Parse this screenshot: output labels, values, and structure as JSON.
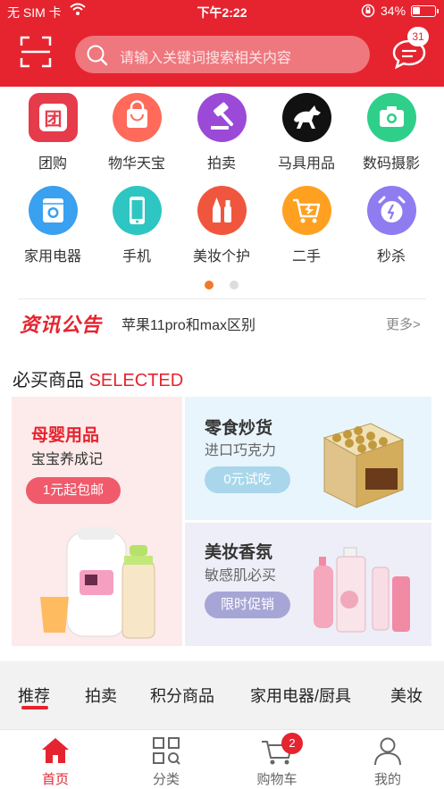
{
  "status_bar": {
    "carrier": "无 SIM 卡",
    "time": "下午2:22",
    "battery": "34%"
  },
  "header": {
    "search_placeholder": "请输入关键词搜索相关内容",
    "message_count": "31"
  },
  "categories": [
    {
      "label": "团购",
      "icon": "group-buy-icon",
      "color": "#e63b4b"
    },
    {
      "label": "物华天宝",
      "icon": "shopping-bag-icon",
      "color": "#ff6a5a"
    },
    {
      "label": "拍卖",
      "icon": "gavel-icon",
      "color": "#9b4ad8"
    },
    {
      "label": "马具用品",
      "icon": "horse-icon",
      "color": "#111111"
    },
    {
      "label": "数码摄影",
      "icon": "camera-icon",
      "color": "#2fcf8a"
    },
    {
      "label": "家用电器",
      "icon": "washing-machine-icon",
      "color": "#3aa0f0"
    },
    {
      "label": "手机",
      "icon": "phone-icon",
      "color": "#2ec6c2"
    },
    {
      "label": "美妆个护",
      "icon": "cosmetics-icon",
      "color": "#f0563e"
    },
    {
      "label": "二手",
      "icon": "cart-icon",
      "color": "#ffa020"
    },
    {
      "label": "秒杀",
      "icon": "alarm-clock-icon",
      "color": "#8e7cf0"
    }
  ],
  "pager": {
    "active_color": "#f07a2a",
    "inactive_color": "#dddddd"
  },
  "news": {
    "logo": "资讯公告",
    "headline": "苹果11pro和max区别",
    "more": "更多>"
  },
  "section": {
    "title_cn": "必买商品",
    "title_en": "SELECTED"
  },
  "cards": {
    "baby": {
      "title": "母婴用品",
      "subtitle": "宝宝养成记",
      "button": "1元起包邮"
    },
    "snack": {
      "title": "零食炒货",
      "subtitle": "进口巧克力",
      "button": "0元试吃"
    },
    "beauty": {
      "title": "美妆香氛",
      "subtitle": "敏感肌必买",
      "button": "限时促销"
    }
  },
  "tabs": [
    "推荐",
    "拍卖",
    "积分商品",
    "家用电器/厨具",
    "美妆"
  ],
  "bottom_nav": [
    {
      "label": "首页",
      "icon": "home-icon"
    },
    {
      "label": "分类",
      "icon": "category-icon"
    },
    {
      "label": "购物车",
      "icon": "cart-icon",
      "badge": "2"
    },
    {
      "label": "我的",
      "icon": "profile-icon"
    }
  ],
  "colors": {
    "brand": "#e5242f"
  }
}
